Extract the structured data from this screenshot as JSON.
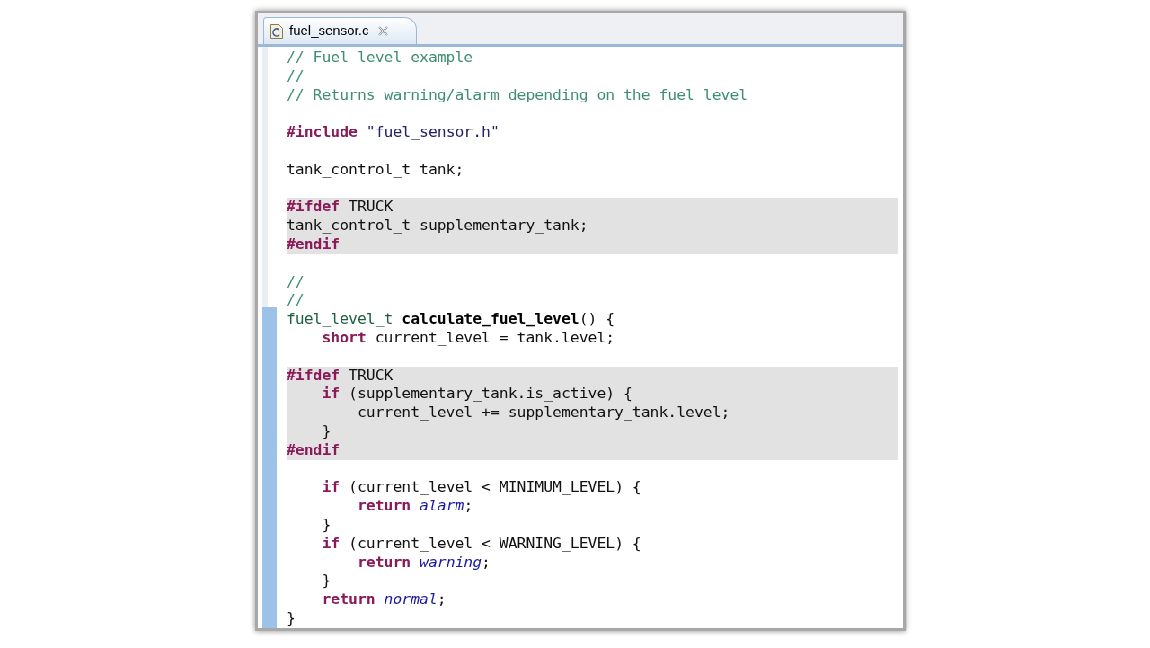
{
  "tabs": [
    {
      "label": "fuel_sensor.c",
      "selected": true
    }
  ],
  "lines": [
    {
      "kind": "code",
      "inactive": false,
      "tokens": [
        {
          "kind": "comment",
          "text": "// Fuel level example"
        }
      ]
    },
    {
      "kind": "code",
      "inactive": false,
      "tokens": [
        {
          "kind": "comment",
          "text": "//"
        }
      ]
    },
    {
      "kind": "code",
      "inactive": false,
      "tokens": [
        {
          "kind": "comment",
          "text": "// Returns warning/alarm depending on the fuel level"
        }
      ]
    },
    {
      "kind": "blank"
    },
    {
      "kind": "code",
      "inactive": false,
      "tokens": [
        {
          "kind": "directive",
          "text": "#include"
        },
        {
          "kind": "string",
          "text": " \"fuel_sensor.h\""
        }
      ]
    },
    {
      "kind": "blank"
    },
    {
      "kind": "code",
      "inactive": false,
      "tokens": [
        {
          "kind": "plain",
          "text": "tank_control_t tank;"
        }
      ]
    },
    {
      "kind": "blank"
    },
    {
      "kind": "code",
      "inactive": true,
      "tokens": [
        {
          "kind": "directive",
          "text": "#ifdef"
        },
        {
          "kind": "plain",
          "text": " TRUCK"
        }
      ]
    },
    {
      "kind": "code",
      "inactive": true,
      "tokens": [
        {
          "kind": "plain",
          "text": "tank_control_t supplementary_tank;"
        }
      ]
    },
    {
      "kind": "code",
      "inactive": true,
      "tokens": [
        {
          "kind": "directive",
          "text": "#endif"
        }
      ]
    },
    {
      "kind": "blank"
    },
    {
      "kind": "code",
      "inactive": false,
      "tokens": [
        {
          "kind": "comment",
          "text": "//"
        }
      ]
    },
    {
      "kind": "code",
      "inactive": false,
      "tokens": [
        {
          "kind": "comment",
          "text": "//"
        }
      ]
    },
    {
      "kind": "code",
      "inactive": false,
      "tokens": [
        {
          "kind": "type",
          "text": "fuel_level_t "
        },
        {
          "kind": "function",
          "text": "calculate_fuel_level"
        },
        {
          "kind": "plain",
          "text": "() {"
        }
      ]
    },
    {
      "kind": "code",
      "inactive": false,
      "tokens": [
        {
          "kind": "keyword",
          "text": "    short"
        },
        {
          "kind": "plain",
          "text": " current_level = tank.level;"
        }
      ]
    },
    {
      "kind": "blank"
    },
    {
      "kind": "code",
      "inactive": true,
      "tokens": [
        {
          "kind": "directive",
          "text": "#ifdef"
        },
        {
          "kind": "plain",
          "text": " TRUCK"
        }
      ]
    },
    {
      "kind": "code",
      "inactive": true,
      "tokens": [
        {
          "kind": "keyword",
          "text": "    if"
        },
        {
          "kind": "plain",
          "text": " (supplementary_tank.is_active) {"
        }
      ]
    },
    {
      "kind": "code",
      "inactive": true,
      "tokens": [
        {
          "kind": "plain",
          "text": "        current_level += supplementary_tank.level;"
        }
      ]
    },
    {
      "kind": "code",
      "inactive": true,
      "tokens": [
        {
          "kind": "plain",
          "text": "    }"
        }
      ]
    },
    {
      "kind": "code",
      "inactive": true,
      "tokens": [
        {
          "kind": "directive",
          "text": "#endif"
        }
      ]
    },
    {
      "kind": "blank"
    },
    {
      "kind": "code",
      "inactive": false,
      "tokens": [
        {
          "kind": "keyword",
          "text": "    if"
        },
        {
          "kind": "plain",
          "text": " (current_level < MINIMUM_LEVEL) {"
        }
      ]
    },
    {
      "kind": "code",
      "inactive": false,
      "tokens": [
        {
          "kind": "keyword",
          "text": "        return "
        },
        {
          "kind": "enum",
          "text": "alarm"
        },
        {
          "kind": "plain",
          "text": ";"
        }
      ]
    },
    {
      "kind": "code",
      "inactive": false,
      "tokens": [
        {
          "kind": "plain",
          "text": "    }"
        }
      ]
    },
    {
      "kind": "code",
      "inactive": false,
      "tokens": [
        {
          "kind": "keyword",
          "text": "    if"
        },
        {
          "kind": "plain",
          "text": " (current_level < WARNING_LEVEL) {"
        }
      ]
    },
    {
      "kind": "code",
      "inactive": false,
      "tokens": [
        {
          "kind": "keyword",
          "text": "        return "
        },
        {
          "kind": "enum",
          "text": "warning"
        },
        {
          "kind": "plain",
          "text": ";"
        }
      ]
    },
    {
      "kind": "code",
      "inactive": false,
      "tokens": [
        {
          "kind": "plain",
          "text": "    }"
        }
      ]
    },
    {
      "kind": "code",
      "inactive": false,
      "tokens": [
        {
          "kind": "keyword",
          "text": "    return "
        },
        {
          "kind": "enum",
          "text": "normal"
        },
        {
          "kind": "plain",
          "text": ";"
        }
      ]
    },
    {
      "kind": "code",
      "inactive": false,
      "tokens": [
        {
          "kind": "plain",
          "text": "}"
        }
      ]
    }
  ]
}
